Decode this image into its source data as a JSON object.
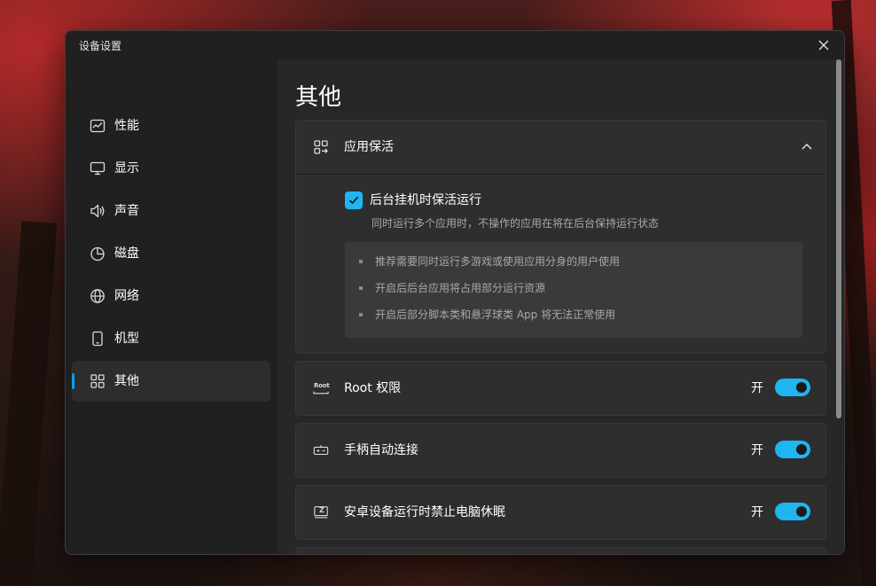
{
  "window": {
    "title": "设备设置"
  },
  "sidebar": {
    "items": [
      {
        "label": "性能",
        "icon": "chart-icon"
      },
      {
        "label": "显示",
        "icon": "monitor-icon"
      },
      {
        "label": "声音",
        "icon": "speaker-icon"
      },
      {
        "label": "磁盘",
        "icon": "pie-chart-icon"
      },
      {
        "label": "网络",
        "icon": "globe-icon"
      },
      {
        "label": "机型",
        "icon": "phone-icon"
      },
      {
        "label": "其他",
        "icon": "apps-icon",
        "active": true
      }
    ]
  },
  "main": {
    "page_title": "其他",
    "keepalive": {
      "title": "应用保活",
      "icon": "apps-arrow-icon",
      "expanded": true,
      "checkbox": {
        "label": "后台挂机时保活运行",
        "checked": true,
        "description": "同时运行多个应用时，不操作的应用在将在后台保持运行状态"
      },
      "tips": [
        "推荐需要同时运行多游戏或使用应用分身的用户使用",
        "开启后后台应用将占用部分运行资源",
        "开启后部分脚本类和悬浮球类 App 将无法正常使用"
      ]
    },
    "settings": [
      {
        "label": "Root 权限",
        "icon": "root-icon",
        "icon_text": "Root",
        "state": "开",
        "enabled": true
      },
      {
        "label": "手柄自动连接",
        "icon": "gamepad-icon",
        "state": "开",
        "enabled": true
      },
      {
        "label": "安卓设备运行时禁止电脑休眠",
        "icon": "sleep-icon",
        "icon_text": "Z",
        "state": "开",
        "enabled": true
      }
    ]
  },
  "colors": {
    "accent": "#1fb5f0",
    "window_bg": "#202020",
    "content_bg": "#272727",
    "card_bg": "#2e2e2e"
  }
}
